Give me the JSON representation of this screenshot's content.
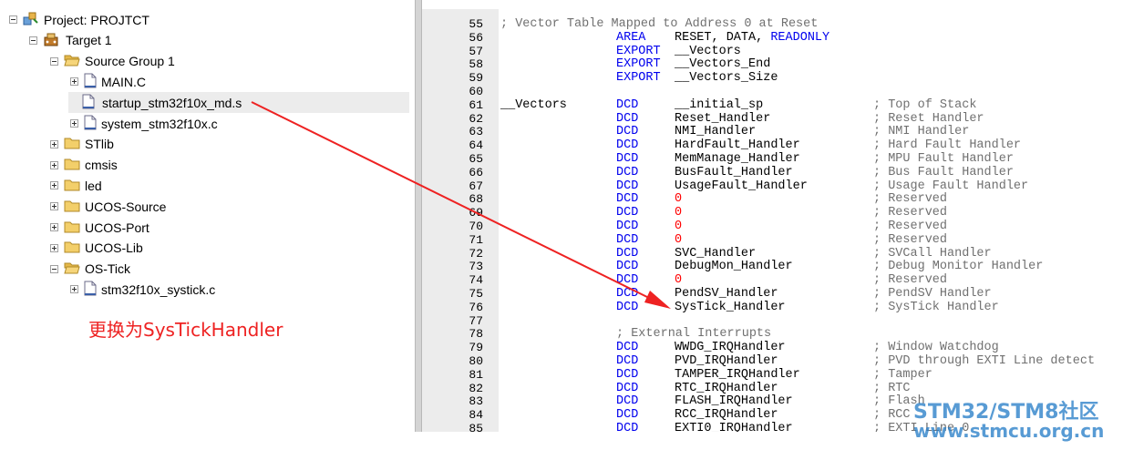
{
  "tree": [
    {
      "label": "Project: PROJTCT",
      "toggle": "minus",
      "icon": "project-icon",
      "depth": 0
    },
    {
      "label": "Target 1",
      "toggle": "minus",
      "icon": "target-icon",
      "depth": 1
    },
    {
      "label": "Source Group 1",
      "toggle": "minus",
      "icon": "folder-open-icon",
      "depth": 2
    },
    {
      "label": "MAIN.C",
      "toggle": "plus",
      "icon": "file-icon",
      "depth": 3
    },
    {
      "label": "startup_stm32f10x_md.s",
      "toggle": "none",
      "icon": "file-icon",
      "depth": 3,
      "selected": true
    },
    {
      "label": "system_stm32f10x.c",
      "toggle": "plus",
      "icon": "file-icon",
      "depth": 3
    },
    {
      "label": "STlib",
      "toggle": "plus",
      "icon": "folder-icon",
      "depth": 2
    },
    {
      "label": "cmsis",
      "toggle": "plus",
      "icon": "folder-icon",
      "depth": 2
    },
    {
      "label": "led",
      "toggle": "plus",
      "icon": "folder-icon",
      "depth": 2
    },
    {
      "label": "UCOS-Source",
      "toggle": "plus",
      "icon": "folder-icon",
      "depth": 2
    },
    {
      "label": "UCOS-Port",
      "toggle": "plus",
      "icon": "folder-icon",
      "depth": 2
    },
    {
      "label": "UCOS-Lib",
      "toggle": "plus",
      "icon": "folder-icon",
      "depth": 2
    },
    {
      "label": "OS-Tick",
      "toggle": "minus",
      "icon": "folder-open-icon",
      "depth": 2
    },
    {
      "label": "stm32f10x_systick.c",
      "toggle": "plus",
      "icon": "file-icon",
      "depth": 3
    }
  ],
  "annotation": {
    "text": "更换为SysTickHandler",
    "color": "#ee2222"
  },
  "colors": {
    "keyword": "#0000ee",
    "comment": "#707070",
    "number": "#ff0000",
    "arrow": "#ee2222"
  },
  "code_lines": [
    {
      "n": "55",
      "label": "",
      "op": "",
      "arg": "",
      "comment": "; Vector Table Mapped to Address 0 at Reset"
    },
    {
      "n": "56",
      "label": "",
      "op": "AREA",
      "arg": "RESET, DATA, READONLY",
      "comment": ""
    },
    {
      "n": "57",
      "label": "",
      "op": "EXPORT",
      "arg": "__Vectors",
      "comment": ""
    },
    {
      "n": "58",
      "label": "",
      "op": "EXPORT",
      "arg": "__Vectors_End",
      "comment": ""
    },
    {
      "n": "59",
      "label": "",
      "op": "EXPORT",
      "arg": "__Vectors_Size",
      "comment": ""
    },
    {
      "n": "60",
      "label": "",
      "op": "",
      "arg": "",
      "comment": ""
    },
    {
      "n": "61",
      "label": "__Vectors",
      "op": "DCD",
      "arg": "__initial_sp",
      "comment": "; Top of Stack"
    },
    {
      "n": "62",
      "label": "",
      "op": "DCD",
      "arg": "Reset_Handler",
      "comment": "; Reset Handler"
    },
    {
      "n": "63",
      "label": "",
      "op": "DCD",
      "arg": "NMI_Handler",
      "comment": "; NMI Handler"
    },
    {
      "n": "64",
      "label": "",
      "op": "DCD",
      "arg": "HardFault_Handler",
      "comment": "; Hard Fault Handler"
    },
    {
      "n": "65",
      "label": "",
      "op": "DCD",
      "arg": "MemManage_Handler",
      "comment": "; MPU Fault Handler"
    },
    {
      "n": "66",
      "label": "",
      "op": "DCD",
      "arg": "BusFault_Handler",
      "comment": "; Bus Fault Handler"
    },
    {
      "n": "67",
      "label": "",
      "op": "DCD",
      "arg": "UsageFault_Handler",
      "comment": "; Usage Fault Handler"
    },
    {
      "n": "68",
      "label": "",
      "op": "DCD",
      "arg": "0",
      "comment": "; Reserved"
    },
    {
      "n": "69",
      "label": "",
      "op": "DCD",
      "arg": "0",
      "comment": "; Reserved"
    },
    {
      "n": "70",
      "label": "",
      "op": "DCD",
      "arg": "0",
      "comment": "; Reserved"
    },
    {
      "n": "71",
      "label": "",
      "op": "DCD",
      "arg": "0",
      "comment": "; Reserved"
    },
    {
      "n": "72",
      "label": "",
      "op": "DCD",
      "arg": "SVC_Handler",
      "comment": "; SVCall Handler"
    },
    {
      "n": "73",
      "label": "",
      "op": "DCD",
      "arg": "DebugMon_Handler",
      "comment": "; Debug Monitor Handler"
    },
    {
      "n": "74",
      "label": "",
      "op": "DCD",
      "arg": "0",
      "comment": "; Reserved"
    },
    {
      "n": "75",
      "label": "",
      "op": "DCD",
      "arg": "PendSV_Handler",
      "comment": "; PendSV Handler"
    },
    {
      "n": "76",
      "label": "",
      "op": "DCD",
      "arg": "SysTick_Handler",
      "comment": "; SysTick Handler"
    },
    {
      "n": "77",
      "label": "",
      "op": "",
      "arg": "",
      "comment": ""
    },
    {
      "n": "78",
      "label": "",
      "op": "",
      "arg": "",
      "comment": "; External Interrupts"
    },
    {
      "n": "79",
      "label": "",
      "op": "DCD",
      "arg": "WWDG_IRQHandler",
      "comment": "; Window Watchdog"
    },
    {
      "n": "80",
      "label": "",
      "op": "DCD",
      "arg": "PVD_IRQHandler",
      "comment": "; PVD through EXTI Line detect"
    },
    {
      "n": "81",
      "label": "",
      "op": "DCD",
      "arg": "TAMPER_IRQHandler",
      "comment": "; Tamper"
    },
    {
      "n": "82",
      "label": "",
      "op": "DCD",
      "arg": "RTC_IRQHandler",
      "comment": "; RTC"
    },
    {
      "n": "83",
      "label": "",
      "op": "DCD",
      "arg": "FLASH_IRQHandler",
      "comment": "; Flash"
    },
    {
      "n": "84",
      "label": "",
      "op": "DCD",
      "arg": "RCC_IRQHandler",
      "comment": "; RCC"
    },
    {
      "n": "85",
      "label": "",
      "op": "DCD",
      "arg": "EXTI0_IRQHandler",
      "comment": "; EXTI Line 0"
    }
  ],
  "watermark": {
    "line1": "STM32/STM8社区",
    "line2": "www.stmcu.org.cn"
  }
}
